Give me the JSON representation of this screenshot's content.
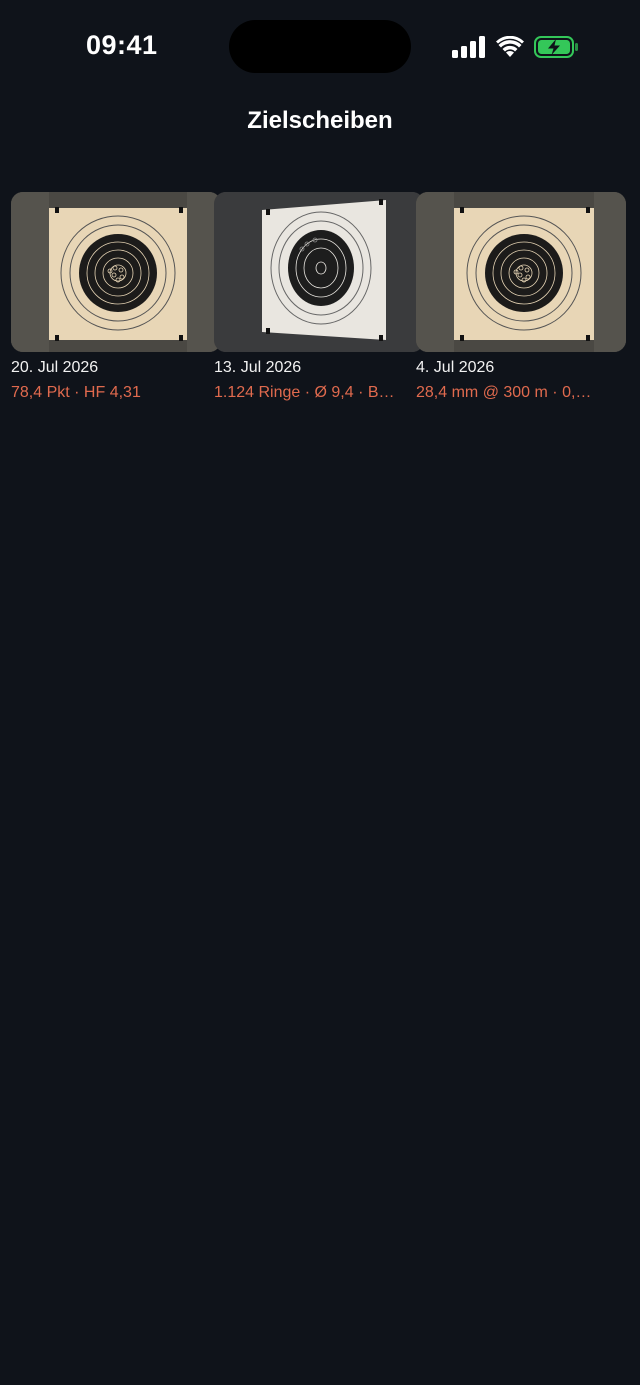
{
  "status_bar": {
    "time": "09:41",
    "icons": [
      "cellular-signal-icon",
      "wifi-icon",
      "battery-charging-icon"
    ],
    "battery_color": "#34c759"
  },
  "header": {
    "title": "Zielscheiben"
  },
  "targets": [
    {
      "date": "20. Jul 2026",
      "metrics": "78,4 Pkt · HF 4,31",
      "image": "target-photo-tan-square"
    },
    {
      "date": "13. Jul 2026",
      "metrics": "1.124 Ringe · Ø 9,4 · B…",
      "image": "target-photo-white-skewed"
    },
    {
      "date": "4. Jul 2026",
      "metrics": "28,4 mm @ 300 m · 0,…",
      "image": "target-photo-tan-square"
    }
  ],
  "colors": {
    "background": "#0f131a",
    "accent": "#e06a4e",
    "text": "#ffffff"
  }
}
